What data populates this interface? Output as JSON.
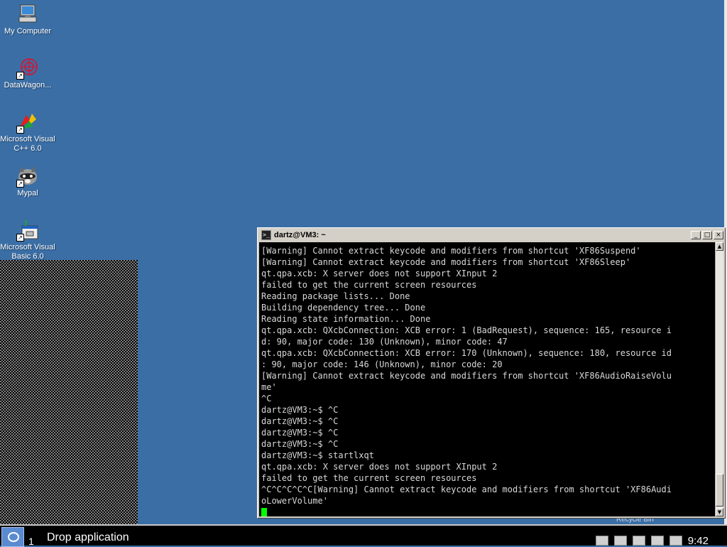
{
  "desktop": {
    "background": "#3a6ea5",
    "icons": [
      {
        "label": "My Computer",
        "icon": "computer-icon"
      },
      {
        "label": "DataWagon...",
        "icon": "datawagon-icon"
      },
      {
        "label": "Microsoft Visual C++ 6.0",
        "icon": "visual-cpp-icon"
      },
      {
        "label": "Mypal",
        "icon": "mypal-raccoon-icon"
      },
      {
        "label": "Microsoft Visual Basic 6.0",
        "icon": "visual-basic-icon"
      }
    ],
    "ghost_text": "Recycle Bin"
  },
  "terminal": {
    "title": "dartz@VM3: ~",
    "buttons": {
      "minimize": "_",
      "maximize": "□",
      "close": "×"
    },
    "lines": [
      "[Warning] Cannot extract keycode and modifiers from shortcut 'XF86Suspend'",
      "[Warning] Cannot extract keycode and modifiers from shortcut 'XF86Sleep'",
      "qt.qpa.xcb: X server does not support XInput 2",
      "failed to get the current screen resources",
      "Reading package lists... Done",
      "Building dependency tree... Done",
      "Reading state information... Done",
      "qt.qpa.xcb: QXcbConnection: XCB error: 1 (BadRequest), sequence: 165, resource i",
      "d: 90, major code: 130 (Unknown), minor code: 47",
      "qt.qpa.xcb: QXcbConnection: XCB error: 170 (Unknown), sequence: 180, resource id",
      ": 90, major code: 146 (Unknown), minor code: 20",
      "[Warning] Cannot extract keycode and modifiers from shortcut 'XF86AudioRaiseVolu",
      "me'",
      "^C",
      "dartz@VM3:~$ ^C",
      "dartz@VM3:~$ ^C",
      "dartz@VM3:~$ ^C",
      "dartz@VM3:~$ ^C",
      "dartz@VM3:~$ startlxqt",
      "qt.qpa.xcb: X server does not support XInput 2",
      "failed to get the current screen resources",
      "^C^C^C^C^C[Warning] Cannot extract keycode and modifiers from shortcut 'XF86Audi",
      "oLowerVolume'"
    ],
    "cursor_color": "#00ff00"
  },
  "taskbar": {
    "desktop_number": "1",
    "task_title": "Drop application",
    "clock": "9:42",
    "tray_icons": [
      "clipboard-icon",
      "network-icon",
      "computer-icon",
      "notes-icon",
      "volume-icon"
    ]
  }
}
